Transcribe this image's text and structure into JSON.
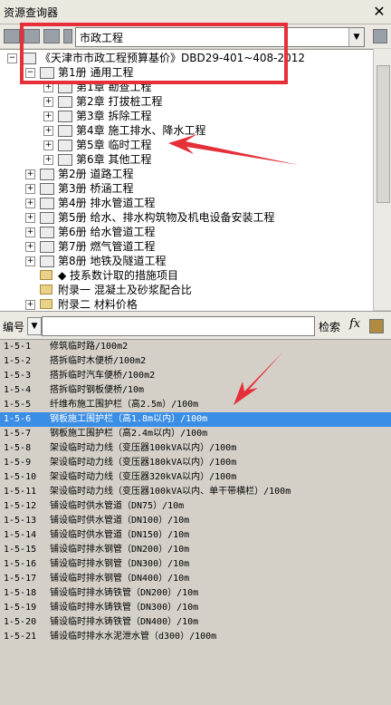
{
  "window": {
    "title": "资源查询器",
    "close_glyph": "✕"
  },
  "toolbar": {
    "combo_value": "市政工程",
    "combo_arrow": "▼"
  },
  "tree": {
    "items": [
      {
        "exp": "−",
        "text": "《天津市市政工程预算基价》DBD29-401~408-2012"
      },
      {
        "exp": "−",
        "text": "第1册  通用工程"
      },
      {
        "exp": "+",
        "text": "第1章  勘查工程"
      },
      {
        "exp": "+",
        "text": "第2章  打拔桩工程"
      },
      {
        "exp": "+",
        "text": "第3章  拆除工程"
      },
      {
        "exp": "+",
        "text": "第4章  施工排水、降水工程"
      },
      {
        "exp": "+",
        "text": "第5章  临时工程"
      },
      {
        "exp": "+",
        "text": "第6章  其他工程"
      },
      {
        "exp": "+",
        "text": "第2册  道路工程"
      },
      {
        "exp": "+",
        "text": "第3册  桥涵工程"
      },
      {
        "exp": "+",
        "text": "第4册  排水管道工程"
      },
      {
        "exp": "+",
        "text": "第5册  给水、排水构筑物及机电设备安装工程"
      },
      {
        "exp": "+",
        "text": "第6册  给水管道工程"
      },
      {
        "exp": "+",
        "text": "第7册  燃气管道工程"
      },
      {
        "exp": "+",
        "text": "第8册  地铁及隧道工程"
      },
      {
        "exp": "",
        "text": "◆  技系数计取的措施项目"
      },
      {
        "exp": "",
        "text": "附录一   混凝土及砂浆配合比"
      },
      {
        "exp": "+",
        "text": "附录二   材料价格"
      }
    ]
  },
  "search": {
    "field_label": "编号",
    "field_arrow": "▼",
    "search_label": "检索",
    "fx_label": "fx"
  },
  "list": {
    "rows": [
      {
        "code": "1-5-1",
        "name": "修筑临时路/100m2"
      },
      {
        "code": "1-5-2",
        "name": "搭拆临时木便桥/100m2"
      },
      {
        "code": "1-5-3",
        "name": "搭拆临时汽车便桥/100m2"
      },
      {
        "code": "1-5-4",
        "name": "搭拆临时钢板便桥/10m"
      },
      {
        "code": "1-5-5",
        "name": "纤维布施工围护栏（高2.5m）/100m"
      },
      {
        "code": "1-5-6",
        "name": "钢板施工围护栏（高1.8m以内）/100m"
      },
      {
        "code": "1-5-7",
        "name": "钢板施工围护栏（高2.4m以内）/100m"
      },
      {
        "code": "1-5-8",
        "name": "架设临时动力线（变压器100kVA以内）/100m"
      },
      {
        "code": "1-5-9",
        "name": "架设临时动力线（变压器180kVA以内）/100m"
      },
      {
        "code": "1-5-10",
        "name": "架设临时动力线（变压器320kVA以内）/100m"
      },
      {
        "code": "1-5-11",
        "name": "架设临时动力线（变压器100kVA以内、单干带横栏）/100m"
      },
      {
        "code": "1-5-12",
        "name": "铺设临时供水管道（DN75）/10m"
      },
      {
        "code": "1-5-13",
        "name": "铺设临时供水管道（DN100）/10m"
      },
      {
        "code": "1-5-14",
        "name": "铺设临时供水管道（DN150）/10m"
      },
      {
        "code": "1-5-15",
        "name": "铺设临时排水钢管（DN200）/10m"
      },
      {
        "code": "1-5-16",
        "name": "铺设临时排水钢管（DN300）/10m"
      },
      {
        "code": "1-5-17",
        "name": "铺设临时排水钢管（DN400）/10m"
      },
      {
        "code": "1-5-18",
        "name": "铺设临时排水铸铁管（DN200）/10m"
      },
      {
        "code": "1-5-19",
        "name": "铺设临时排水铸铁管（DN300）/10m"
      },
      {
        "code": "1-5-20",
        "name": "铺设临时排水铸铁管（DN400）/10m"
      },
      {
        "code": "1-5-21",
        "name": "铺设临时排水水泥泄水管（d300）/100m"
      }
    ],
    "selected_index": 5,
    "selected_color": "#3a8ee6"
  },
  "annotations": {
    "color": "#e5303a"
  }
}
